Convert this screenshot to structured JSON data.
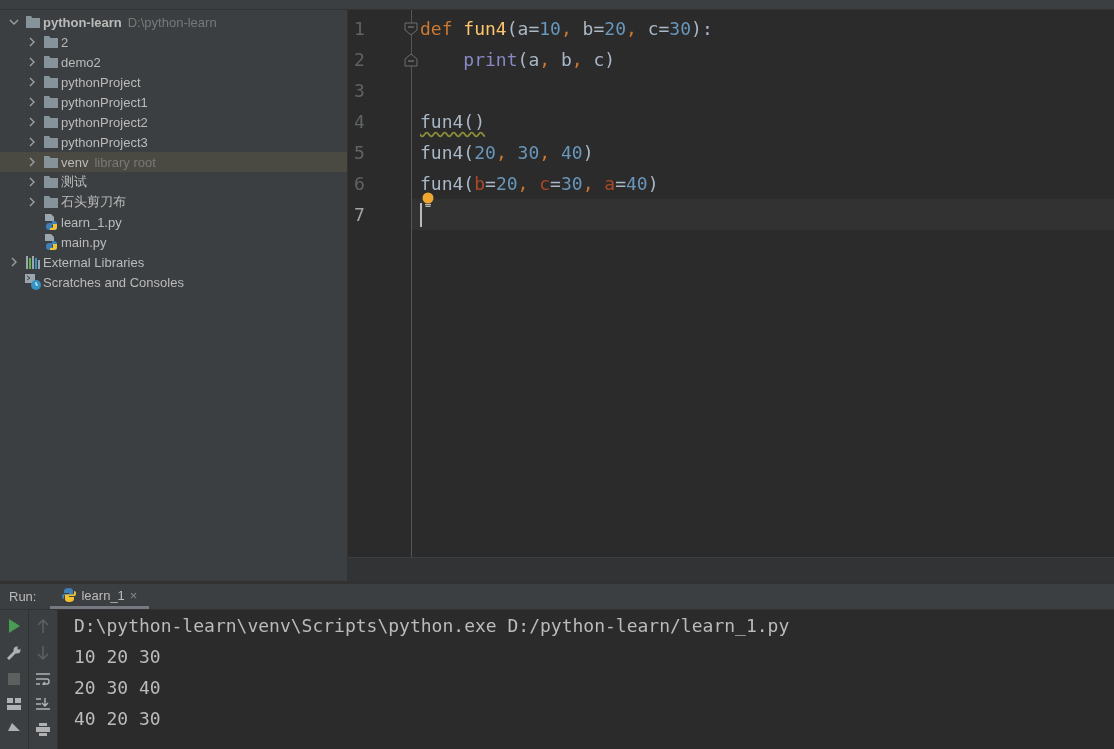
{
  "project_panel": {
    "tree": [
      {
        "label": "python-learn",
        "hint": "D:\\python-learn",
        "kind": "folder",
        "expanded": true,
        "selected": false,
        "children": [
          {
            "label": "2",
            "kind": "folder",
            "expanded": false,
            "selected": false
          },
          {
            "label": "demo2",
            "kind": "folder",
            "expanded": false,
            "selected": false
          },
          {
            "label": "pythonProject",
            "kind": "folder",
            "expanded": false,
            "selected": false
          },
          {
            "label": "pythonProject1",
            "kind": "folder",
            "expanded": false,
            "selected": false
          },
          {
            "label": "pythonProject2",
            "kind": "folder",
            "expanded": false,
            "selected": false
          },
          {
            "label": "pythonProject3",
            "kind": "folder",
            "expanded": false,
            "selected": false
          },
          {
            "label": "venv",
            "hint": "library root",
            "kind": "folder",
            "expanded": false,
            "selected": true
          },
          {
            "label": "测试",
            "kind": "folder",
            "expanded": false,
            "selected": false
          },
          {
            "label": "石头剪刀布",
            "kind": "folder",
            "expanded": false,
            "selected": false
          },
          {
            "label": "learn_1.py",
            "kind": "python",
            "selected": false
          },
          {
            "label": "main.py",
            "kind": "python",
            "selected": false
          }
        ]
      },
      {
        "label": "External Libraries",
        "kind": "library",
        "expanded": false,
        "selected": false
      },
      {
        "label": "Scratches and Consoles",
        "kind": "scratches",
        "selected": false
      }
    ]
  },
  "editor": {
    "lines": [
      {
        "number": "1",
        "fold_start": true,
        "fold_end": false,
        "current": false,
        "warning": false,
        "bulb": false,
        "tokens": [
          {
            "text": "def ",
            "kind": "keyword"
          },
          {
            "text": "fun4",
            "kind": "funcdef"
          },
          {
            "text": "(a=",
            "kind": "plain"
          },
          {
            "text": "10",
            "kind": "number"
          },
          {
            "text": ", ",
            "kind": "comma"
          },
          {
            "text": "b=",
            "kind": "plain"
          },
          {
            "text": "20",
            "kind": "number"
          },
          {
            "text": ", ",
            "kind": "comma"
          },
          {
            "text": "c=",
            "kind": "plain"
          },
          {
            "text": "30",
            "kind": "number"
          },
          {
            "text": "):",
            "kind": "plain"
          }
        ]
      },
      {
        "number": "2",
        "fold_start": false,
        "fold_end": true,
        "current": false,
        "warning": false,
        "bulb": false,
        "tokens": [
          {
            "text": "    print",
            "kind": "builtin"
          },
          {
            "text": "(a",
            "kind": "plain"
          },
          {
            "text": ", ",
            "kind": "comma"
          },
          {
            "text": "b",
            "kind": "plain"
          },
          {
            "text": ", ",
            "kind": "comma"
          },
          {
            "text": "c)",
            "kind": "plain"
          }
        ]
      },
      {
        "number": "3",
        "fold_start": false,
        "fold_end": false,
        "current": false,
        "warning": false,
        "bulb": false
      },
      {
        "number": "4",
        "fold_start": false,
        "fold_end": false,
        "current": false,
        "warning": true,
        "bulb": false,
        "tokens": [
          {
            "text": "fun4()",
            "kind": "plain"
          }
        ]
      },
      {
        "number": "5",
        "fold_start": false,
        "fold_end": false,
        "current": false,
        "warning": false,
        "bulb": false,
        "tokens": [
          {
            "text": "fun4(",
            "kind": "plain"
          },
          {
            "text": "20",
            "kind": "number"
          },
          {
            "text": ", ",
            "kind": "comma"
          },
          {
            "text": "30",
            "kind": "number"
          },
          {
            "text": ", ",
            "kind": "comma"
          },
          {
            "text": "40",
            "kind": "number"
          },
          {
            "text": ")",
            "kind": "plain"
          }
        ]
      },
      {
        "number": "6",
        "fold_start": false,
        "fold_end": false,
        "current": false,
        "warning": false,
        "bulb": true,
        "tokens": [
          {
            "text": "fun4(",
            "kind": "plain"
          },
          {
            "text": "b",
            "kind": "named_arg"
          },
          {
            "text": "=",
            "kind": "plain"
          },
          {
            "text": "20",
            "kind": "number"
          },
          {
            "text": ", ",
            "kind": "comma"
          },
          {
            "text": "c",
            "kind": "named_arg"
          },
          {
            "text": "=",
            "kind": "plain"
          },
          {
            "text": "30",
            "kind": "number"
          },
          {
            "text": ", ",
            "kind": "comma"
          },
          {
            "text": "a",
            "kind": "named_arg"
          },
          {
            "text": "=",
            "kind": "plain"
          },
          {
            "text": "40",
            "kind": "number"
          },
          {
            "text": ")",
            "kind": "plain"
          }
        ]
      },
      {
        "number": "7",
        "fold_start": false,
        "fold_end": false,
        "current": true,
        "warning": false,
        "bulb": false
      }
    ]
  },
  "run_panel": {
    "label": "Run:",
    "tabs": [
      {
        "label": "learn_1",
        "close": "×",
        "selected": true
      }
    ],
    "output": [
      "D:\\python-learn\\venv\\Scripts\\python.exe D:/python-learn/learn_1.py",
      "10 20 30",
      "20 30 40",
      "40 20 30"
    ]
  }
}
